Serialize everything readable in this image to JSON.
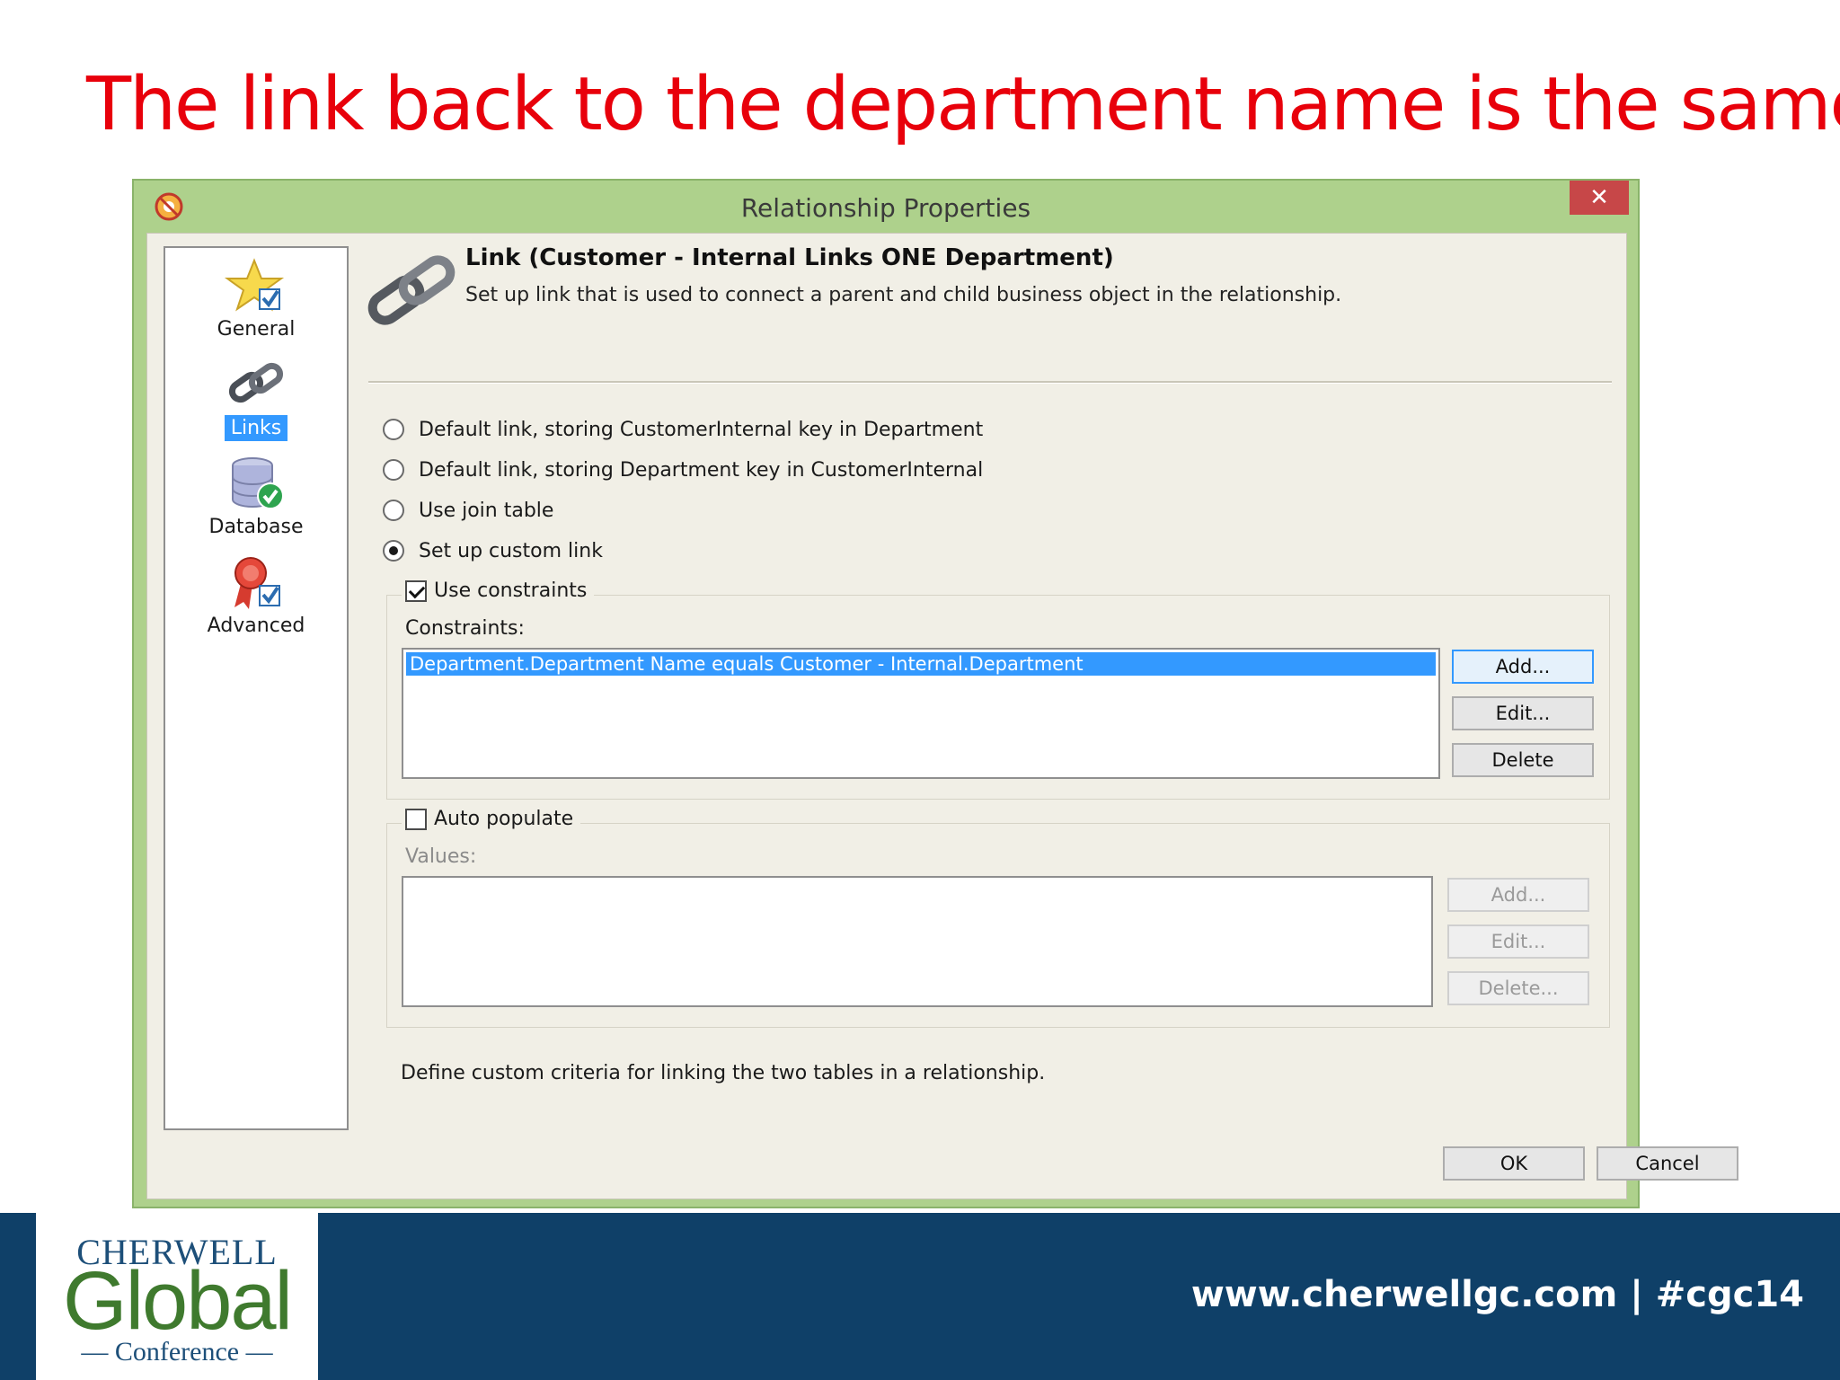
{
  "slide": {
    "title": "The link back to the department name is the same"
  },
  "dialog": {
    "title": "Relationship Properties",
    "close_label": "✕",
    "sidebar": {
      "items": [
        {
          "label": "General",
          "icon": "star-check-icon",
          "selected": false
        },
        {
          "label": "Links",
          "icon": "chain-link-icon",
          "selected": true
        },
        {
          "label": "Database",
          "icon": "database-check-icon",
          "selected": false
        },
        {
          "label": "Advanced",
          "icon": "ribbon-check-icon",
          "selected": false
        }
      ]
    },
    "header": {
      "title": "Link  (Customer - Internal Links ONE Department)",
      "description": "Set up link that is used to connect a parent and child business object in the relationship."
    },
    "link_options": [
      {
        "label": "Default link, storing CustomerInternal key in Department",
        "checked": false
      },
      {
        "label": "Default link, storing Department key in CustomerInternal",
        "checked": false
      },
      {
        "label": "Use join table",
        "checked": false
      },
      {
        "label": "Set up custom link",
        "checked": true
      }
    ],
    "constraints_group": {
      "checkbox_label": "Use constraints",
      "checked": true,
      "list_label": "Constraints:",
      "items": [
        "Department.Department Name equals Customer - Internal.Department"
      ],
      "buttons": {
        "add": "Add...",
        "edit": "Edit...",
        "delete": "Delete"
      }
    },
    "values_group": {
      "checkbox_label": "Auto populate",
      "checked": false,
      "list_label": "Values:",
      "buttons": {
        "add": "Add...",
        "edit": "Edit...",
        "delete": "Delete..."
      }
    },
    "footer_description": "Define custom criteria for linking the two tables in a relationship.",
    "ok_label": "OK",
    "cancel_label": "Cancel"
  },
  "banner": {
    "logo_top": "CHERWELL",
    "logo_mid": "Global",
    "logo_bottom": "— Conference —",
    "url": "www.cherwellgc.com | #cgc14"
  },
  "colors": {
    "title_red": "#e8000b",
    "dialog_frame": "#aed18c",
    "selection_blue": "#3399ff",
    "close_red": "#c74748",
    "banner_navy": "#0f4068",
    "logo_green": "#3f7a2e"
  }
}
